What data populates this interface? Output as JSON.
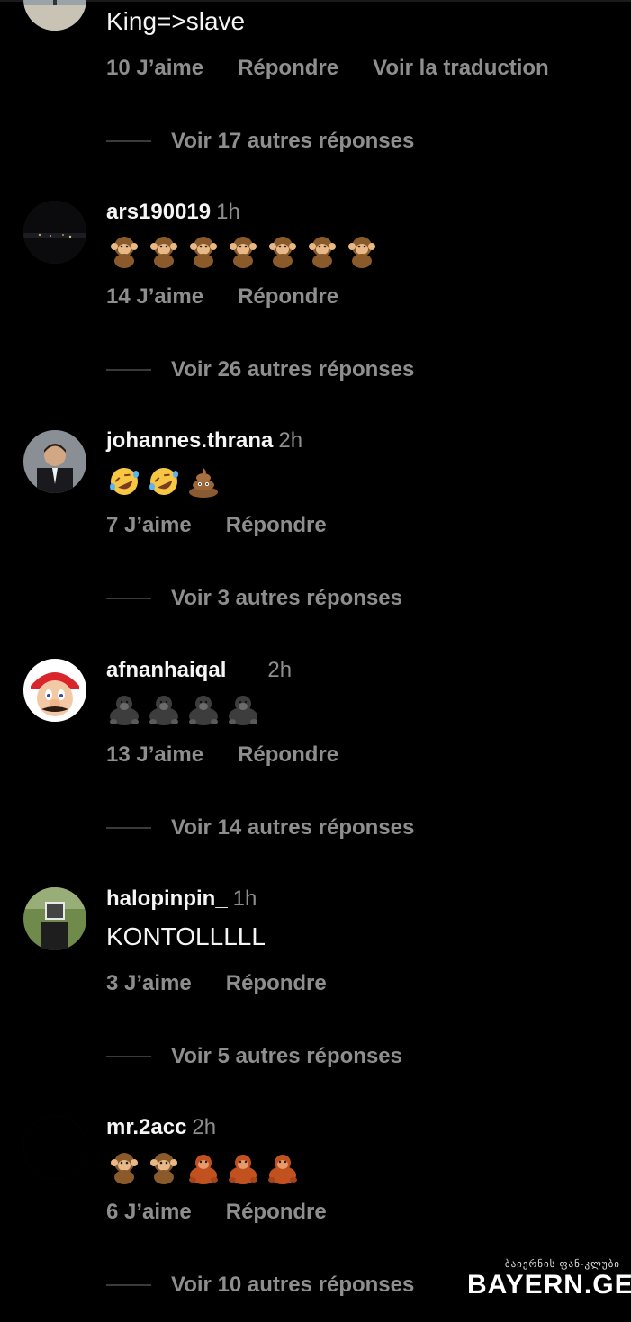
{
  "comments": [
    {
      "username": "",
      "time": "",
      "text": "King=>slave",
      "emojis": [],
      "likes": "10 J’aime",
      "reply": "Répondre",
      "translate": "Voir la traduction",
      "view_replies": "Voir 17 autres réponses",
      "avatar": "avatar-person-beach"
    },
    {
      "username": "ars190019",
      "time": "1h",
      "text": "",
      "emojis": [
        "monkey-emoji",
        "monkey-emoji",
        "monkey-emoji",
        "monkey-emoji",
        "monkey-emoji",
        "monkey-emoji",
        "monkey-emoji"
      ],
      "likes": "14 J’aime",
      "reply": "Répondre",
      "view_replies": "Voir 26 autres réponses",
      "avatar": "avatar-night-city"
    },
    {
      "username": "johannes.thrana",
      "time": "2h",
      "text": "",
      "emojis": [
        "rofl-emoji",
        "rofl-emoji",
        "poop-emoji"
      ],
      "likes": "7 J’aime",
      "reply": "Répondre",
      "view_replies": "Voir 3 autres réponses",
      "avatar": "avatar-man-suit"
    },
    {
      "username": "afnanhaiqal___",
      "time": "2h",
      "text": "",
      "emojis": [
        "gorilla-emoji",
        "gorilla-emoji",
        "gorilla-emoji",
        "gorilla-emoji"
      ],
      "likes": "13 J’aime",
      "reply": "Répondre",
      "view_replies": "Voir 14 autres réponses",
      "avatar": "avatar-mario"
    },
    {
      "username": "halopinpin_",
      "time": "1h",
      "text": "KONTOLLLLL",
      "emojis": [],
      "likes": "3 J’aime",
      "reply": "Répondre",
      "view_replies": "Voir 5 autres réponses",
      "avatar": "avatar-person-park"
    },
    {
      "username": "mr.2acc",
      "time": "2h",
      "text": "",
      "emojis": [
        "monkey-emoji",
        "monkey-emoji",
        "orangutan-emoji",
        "orangutan-emoji",
        "orangutan-emoji"
      ],
      "likes": "6 J’aime",
      "reply": "Répondre",
      "view_replies": "Voir 10 autres réponses",
      "avatar": "avatar-blank"
    }
  ],
  "watermark": {
    "small": "ბაიერნის ფან-კლუბი",
    "big": "BAYERN.GE"
  },
  "colors": {
    "background": "#000000",
    "primary_text": "#f5f5f5",
    "secondary_text": "#8e8e8e"
  }
}
